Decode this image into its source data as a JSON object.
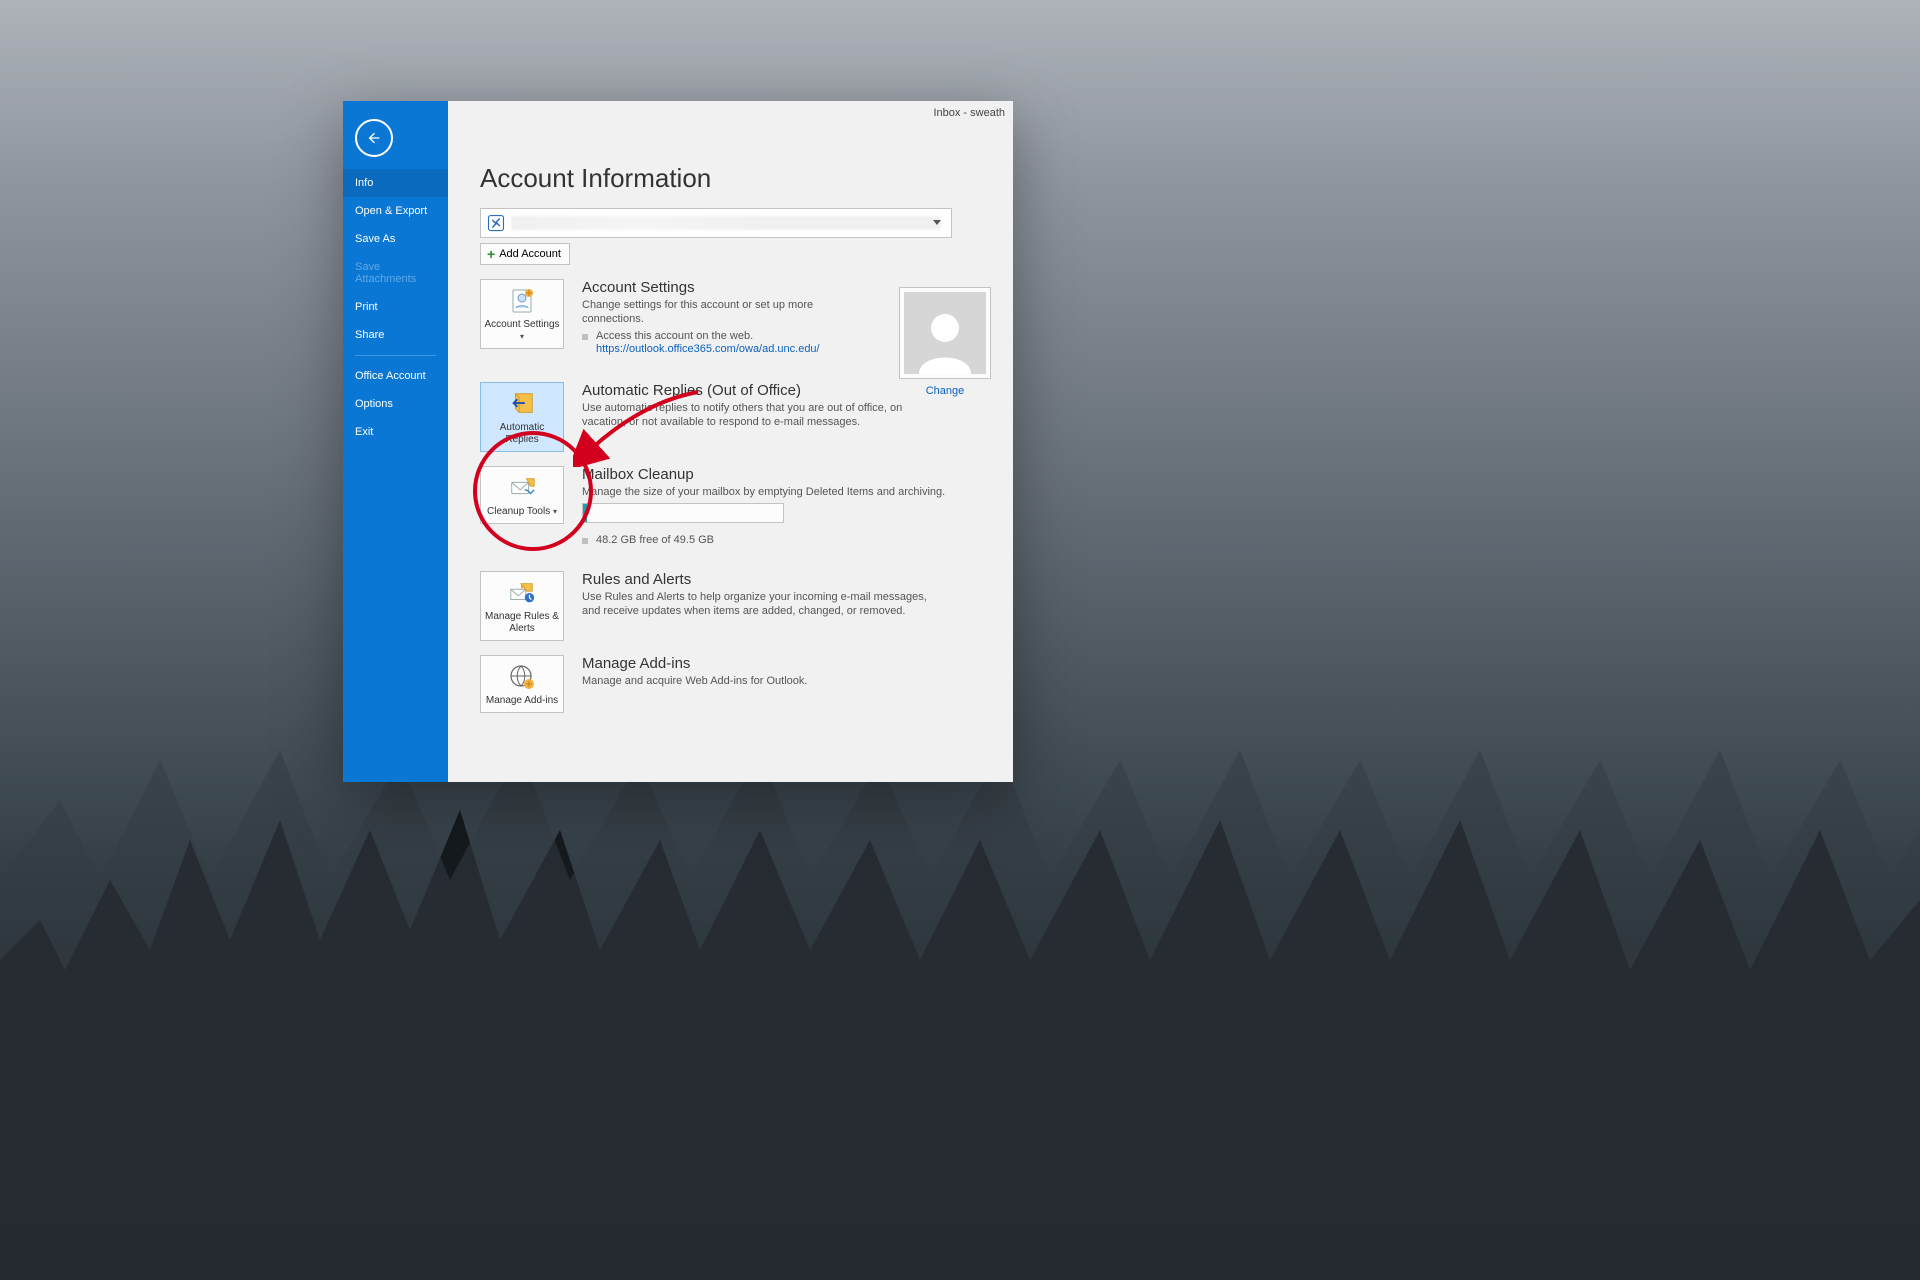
{
  "titlebar": "Inbox - sweath",
  "sidebar": {
    "items": [
      {
        "label": "Info",
        "active": true
      },
      {
        "label": "Open & Export"
      },
      {
        "label": "Save As"
      },
      {
        "label": "Save Attachments",
        "disabled": true
      },
      {
        "label": "Print"
      },
      {
        "label": "Share"
      }
    ],
    "lower": [
      {
        "label": "Office Account"
      },
      {
        "label": "Options"
      },
      {
        "label": "Exit"
      }
    ]
  },
  "page": {
    "title": "Account Information",
    "add_account": "Add Account"
  },
  "avatar": {
    "change": "Change"
  },
  "sections": {
    "account_settings": {
      "tile": "Account Settings",
      "title": "Account Settings",
      "desc": "Change settings for this account or set up more connections.",
      "sub": "Access this account on the web.",
      "url": "https://outlook.office365.com/owa/ad.unc.edu/"
    },
    "auto_replies": {
      "tile": "Automatic Replies",
      "title": "Automatic Replies (Out of Office)",
      "desc": "Use automatic replies to notify others that you are out of office, on vacation, or not available to respond to e-mail messages."
    },
    "mailbox": {
      "tile": "Cleanup Tools",
      "title": "Mailbox Cleanup",
      "desc": "Manage the size of your mailbox by emptying Deleted Items and archiving.",
      "storage": "48.2 GB free of 49.5 GB"
    },
    "rules": {
      "tile": "Manage Rules & Alerts",
      "title": "Rules and Alerts",
      "desc": "Use Rules and Alerts to help organize your incoming e-mail messages, and receive updates when items are added, changed, or removed."
    },
    "addins": {
      "tile": "Manage Add-ins",
      "title": "Manage Add-ins",
      "desc": "Manage and acquire Web Add-ins for Outlook."
    }
  }
}
